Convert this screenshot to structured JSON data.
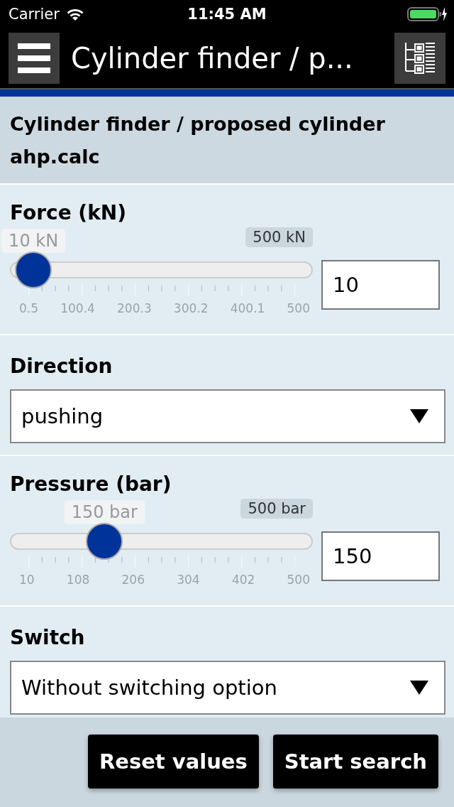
{
  "status_bar": {
    "carrier": "Carrier",
    "time": "11:45 AM"
  },
  "header": {
    "title": "Cylinder finder / p..."
  },
  "form_title": "Cylinder finder / proposed cylinder ahp.calc",
  "fields": [
    {
      "kind": "slider",
      "label": "Force (kN)",
      "value_bubble": "10 kN",
      "max_bubble": "500 kN",
      "level": 0.019,
      "scale": [
        "0.5",
        "100.4",
        "200.3",
        "300.2",
        "400.1",
        "500"
      ],
      "value": "10"
    },
    {
      "kind": "select",
      "label": "Direction",
      "value": "pushing"
    },
    {
      "kind": "slider",
      "label": "Pressure (bar)",
      "value_bubble": "150 bar",
      "max_bubble": "500 bar",
      "level": 0.286,
      "scale": [
        "10",
        "108",
        "206",
        "304",
        "402",
        "500"
      ],
      "value": "150"
    },
    {
      "kind": "select",
      "label": "Switch",
      "value": "Without switching option"
    }
  ],
  "buttons": [
    "Reset values",
    "Start search"
  ]
}
